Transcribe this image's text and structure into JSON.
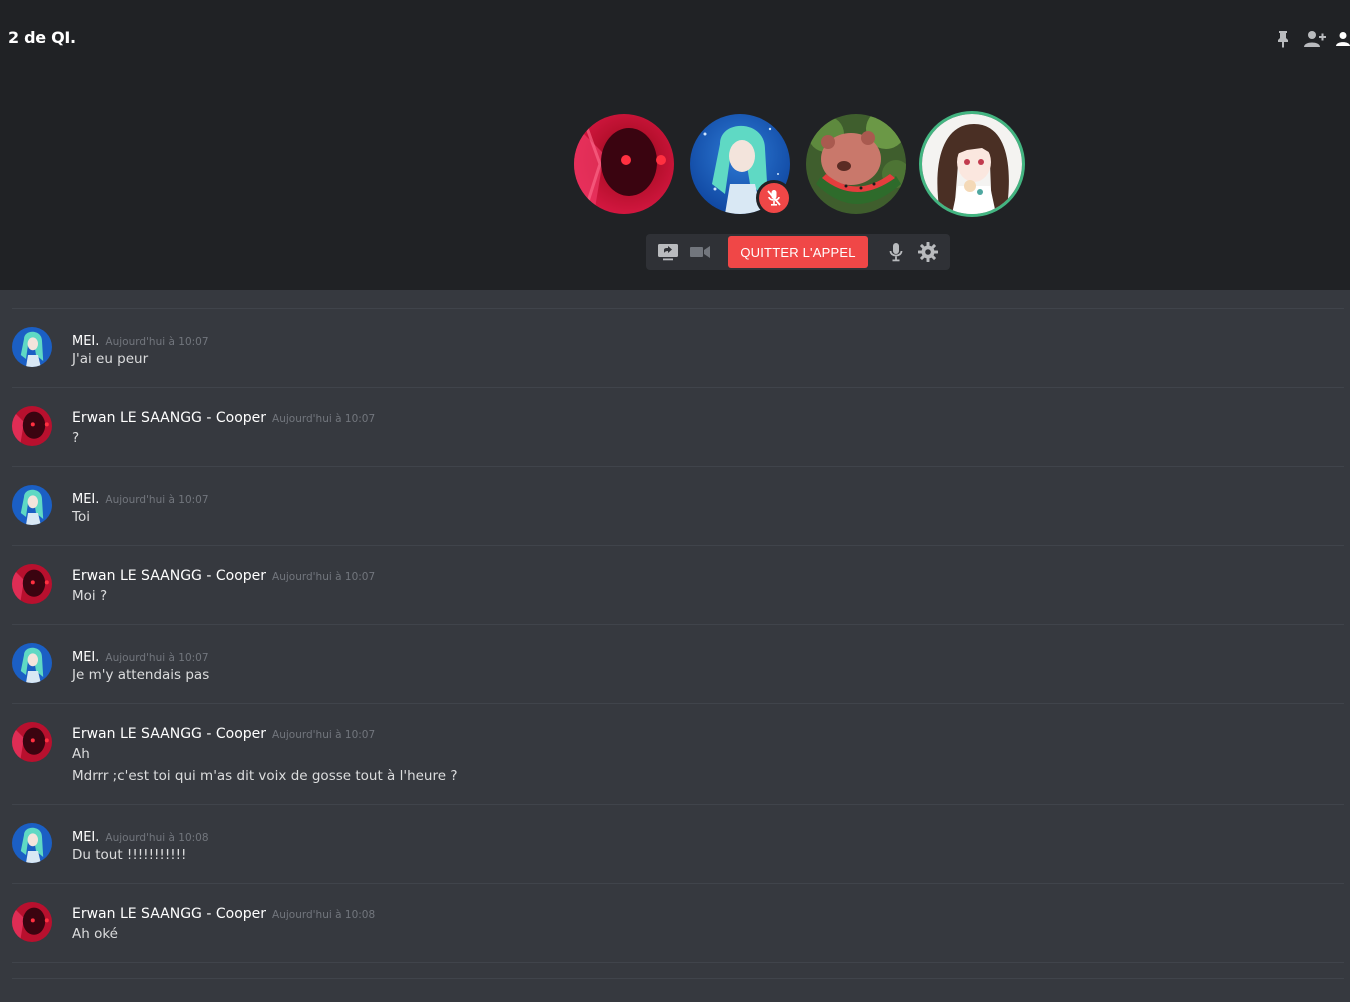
{
  "header": {
    "title": "2 de QI."
  },
  "call": {
    "leave_label": "QUITTER L'APPEL",
    "participants": [
      {
        "name": "Erwan LE SAANGG - Cooper",
        "avatar": "red-anime-avatar",
        "muted": false,
        "speaking": false
      },
      {
        "name": "MEI.",
        "avatar": "blue-anime-avatar",
        "muted": true,
        "speaking": false
      },
      {
        "name": "watermelon-bear",
        "avatar": "watermelon-bear-avatar",
        "muted": false,
        "speaking": false
      },
      {
        "name": "anime-girl",
        "avatar": "anime-girl-avatar",
        "muted": false,
        "speaking": true
      }
    ]
  },
  "messages": [
    {
      "author": "MEI.",
      "timestamp": "Aujourd'hui à 10:07",
      "lines": [
        "J'ai eu peur"
      ]
    },
    {
      "author": "Erwan LE SAANGG - Cooper",
      "timestamp": "Aujourd'hui à 10:07",
      "lines": [
        "?"
      ]
    },
    {
      "author": "MEI.",
      "timestamp": "Aujourd'hui à 10:07",
      "lines": [
        "Toi"
      ]
    },
    {
      "author": "Erwan LE SAANGG - Cooper",
      "timestamp": "Aujourd'hui à 10:07",
      "lines": [
        "Moi ?"
      ]
    },
    {
      "author": "MEI.",
      "timestamp": "Aujourd'hui à 10:07",
      "lines": [
        "Je m'y attendais pas"
      ]
    },
    {
      "author": "Erwan LE SAANGG - Cooper",
      "timestamp": "Aujourd'hui à 10:07",
      "lines": [
        "Ah",
        "Mdrrr ;c'est toi qui m'as dit voix de gosse tout à l'heure ?"
      ]
    },
    {
      "author": "MEI.",
      "timestamp": "Aujourd'hui à 10:08",
      "lines": [
        "Du tout !!!!!!!!!!!"
      ]
    },
    {
      "author": "Erwan LE SAANGG - Cooper",
      "timestamp": "Aujourd'hui à 10:08",
      "lines": [
        "Ah oké"
      ]
    }
  ],
  "colors": {
    "background": "#36393f",
    "call_background": "#202225",
    "danger": "#f04747",
    "speaking": "#43b581"
  }
}
